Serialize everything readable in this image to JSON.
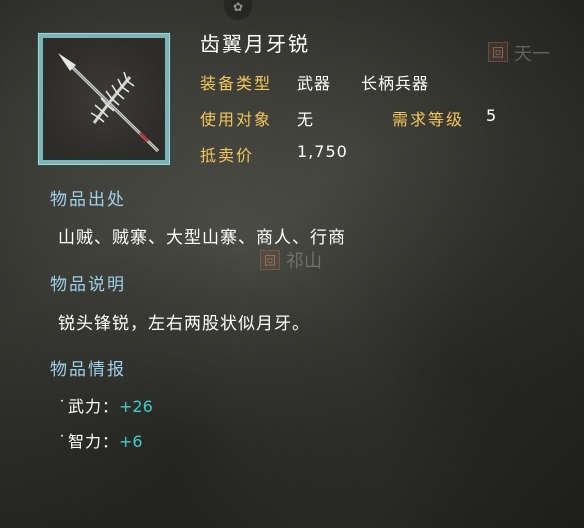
{
  "map": {
    "top_icon": "✿",
    "label_right": "天一",
    "marker_right": "回",
    "label_mid": "祁山",
    "marker_mid": "回"
  },
  "item": {
    "name": "齿翼月牙锐",
    "icon": "crescent-spear-icon",
    "fields": {
      "equip_type_label": "装备类型",
      "equip_type_value": "武器",
      "equip_subtype_value": "长柄兵器",
      "target_label": "使用对象",
      "target_value": "无",
      "level_label": "需求等级",
      "level_value": "5",
      "price_label": "抵卖价",
      "price_value": "1,750"
    },
    "source": {
      "heading": "物品出处",
      "text": "山贼、贼寨、大型山寨、商人、行商"
    },
    "description": {
      "heading": "物品说明",
      "text": "锐头锋锐，左右两股状似月牙。"
    },
    "intel": {
      "heading": "物品情报",
      "stats": [
        {
          "dot": "˙",
          "name": "武力：",
          "value": "+26"
        },
        {
          "dot": "˙",
          "name": "智力：",
          "value": "+6"
        }
      ]
    }
  },
  "colors": {
    "label_gold": "#f2c65a",
    "heading_blue": "#9ed1ea",
    "stat_cyan": "#3fd0c8",
    "frame_teal": "#7fb3b5"
  }
}
